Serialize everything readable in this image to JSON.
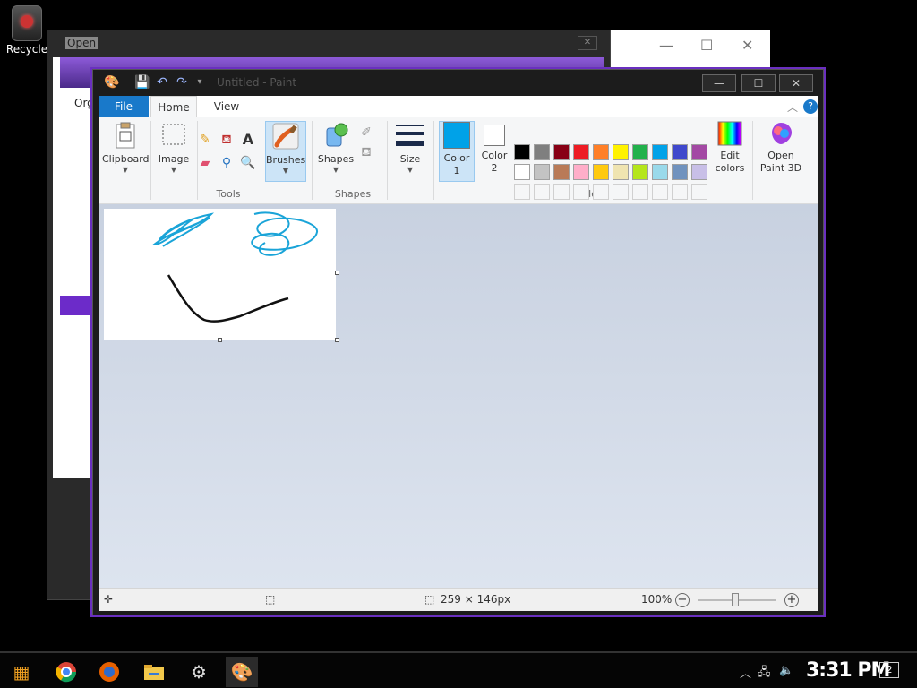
{
  "desktop": {
    "recycle_label": "Recycle"
  },
  "background_window": {
    "title": "Open",
    "toolbar_text": "Org"
  },
  "paint": {
    "title": "Untitled - Paint",
    "tabs": {
      "file": "File",
      "home": "Home",
      "view": "View"
    },
    "ribbon": {
      "clipboard": "Clipboard",
      "image": "Image",
      "tools_group": "Tools",
      "brushes": "Brushes",
      "shapes": "Shapes",
      "shapes_group": "Shapes",
      "size": "Size",
      "color1_line1": "Color",
      "color1_line2": "1",
      "color2_line1": "Color",
      "color2_line2": "2",
      "colors_group": "Colors",
      "edit_colors_line1": "Edit",
      "edit_colors_line2": "colors",
      "open3d_line1": "Open",
      "open3d_line2": "Paint 3D"
    },
    "palette_row1": [
      "#000000",
      "#7f7f7f",
      "#880015",
      "#ed1c24",
      "#ff7f27",
      "#fff200",
      "#22b14c",
      "#00a2e8",
      "#3f48cc",
      "#a349a4"
    ],
    "palette_row2": [
      "#ffffff",
      "#c3c3c3",
      "#b97a57",
      "#ffaec9",
      "#ffc90e",
      "#efe4b0",
      "#b5e61d",
      "#99d9ea",
      "#7092be",
      "#c8bfe7"
    ],
    "color1": "#00a2e8",
    "color2": "#ffffff",
    "status": {
      "dimensions": "259 × 146px",
      "zoom": "100%"
    }
  },
  "taskbar": {
    "time": "3:31 PM",
    "notification_count": "2"
  }
}
